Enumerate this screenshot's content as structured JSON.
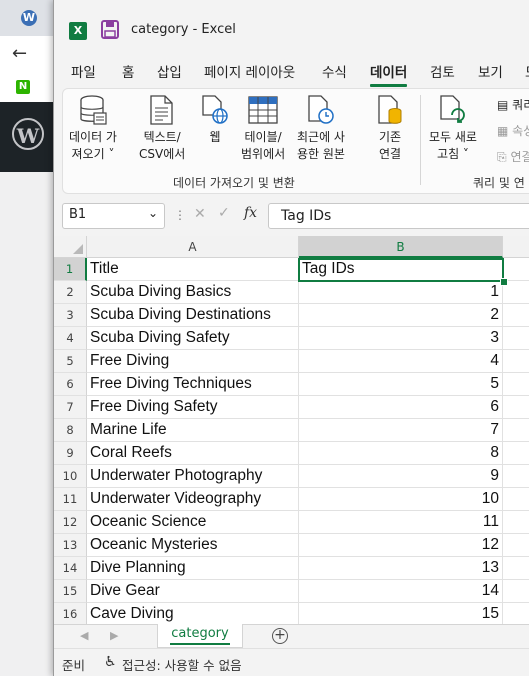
{
  "excel": {
    "title": "category  -  Excel",
    "tabs": [
      "파일",
      "홈",
      "삽입",
      "페이지 레이아웃",
      "수식",
      "데이터",
      "검토",
      "보기",
      "도"
    ],
    "active_tab": "데이터",
    "ribbon": {
      "get_data": [
        "데이터 가",
        "져오기 ˅"
      ],
      "text_csv": [
        "텍스트/",
        "CSV에서"
      ],
      "web": [
        "웹"
      ],
      "table_range": [
        "테이블/",
        "범위에서"
      ],
      "recent": [
        "최근에 사",
        "용한 원본"
      ],
      "existing": [
        "기존",
        "연결"
      ],
      "refresh_all": [
        "모두 새로",
        "고침 ˅"
      ],
      "group1_label": "데이터 가져오기 및 변환",
      "group2_label": "쿼리 및 연",
      "queries": "쿼리",
      "properties": "속성",
      "links": "연결"
    },
    "formula_bar": {
      "name_box": "B1",
      "fx": "fx",
      "value": "Tag IDs"
    },
    "columns": [
      "A",
      "B"
    ],
    "rows": [
      {
        "n": "1",
        "a": "Title",
        "b": "Tag IDs"
      },
      {
        "n": "2",
        "a": "Scuba Diving Basics",
        "b": "1"
      },
      {
        "n": "3",
        "a": "Scuba Diving Destinations",
        "b": "2"
      },
      {
        "n": "4",
        "a": "Scuba Diving Safety",
        "b": "3"
      },
      {
        "n": "5",
        "a": "Free Diving",
        "b": "4"
      },
      {
        "n": "6",
        "a": "Free Diving Techniques",
        "b": "5"
      },
      {
        "n": "7",
        "a": "Free Diving Safety",
        "b": "6"
      },
      {
        "n": "8",
        "a": "Marine Life",
        "b": "7"
      },
      {
        "n": "9",
        "a": "Coral Reefs",
        "b": "8"
      },
      {
        "n": "10",
        "a": "Underwater Photography",
        "b": "9"
      },
      {
        "n": "11",
        "a": "Underwater Videography",
        "b": "10"
      },
      {
        "n": "12",
        "a": "Oceanic Science",
        "b": "11"
      },
      {
        "n": "13",
        "a": "Oceanic Mysteries",
        "b": "12"
      },
      {
        "n": "14",
        "a": "Dive Planning",
        "b": "13"
      },
      {
        "n": "15",
        "a": "Dive Gear",
        "b": "14"
      },
      {
        "n": "16",
        "a": "Cave Diving",
        "b": "15"
      }
    ],
    "sheet_tab": "category",
    "status": {
      "ready": "준비",
      "accessibility": "접근성: 사용할 수 없음"
    },
    "accent": "#107c41"
  },
  "background": {
    "wp_favicon": "W",
    "naver": "N"
  }
}
